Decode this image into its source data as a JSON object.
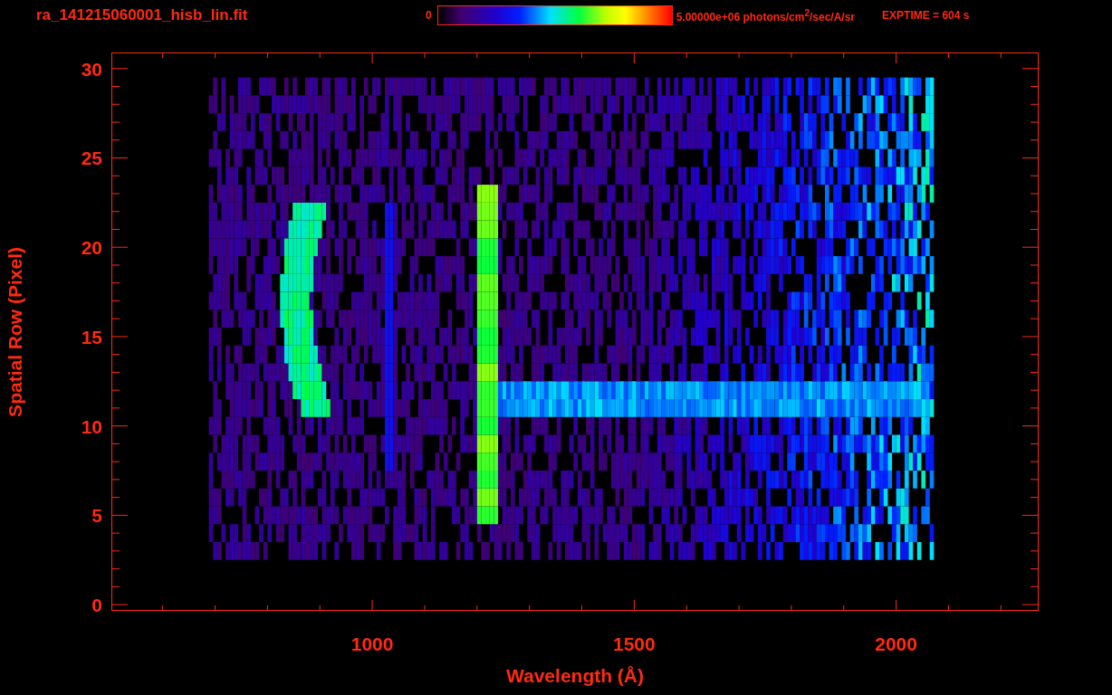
{
  "header": {
    "title": "ra_141215060001_hisb_lin.fit",
    "colorbar_min": "0",
    "colorbar_max": "5.00000e+06 photons/cm$^{2}$/sec/A/sr",
    "exposure": "EXPTIME = 604 s"
  },
  "plot": {
    "ylabel": "Spatial Row (Pixel)",
    "xlabel": "Wavelength (Å)",
    "xticks": [
      "1000",
      "1500",
      "2000"
    ],
    "yticks": [
      "30",
      "25",
      "20",
      "15",
      "10",
      "5",
      "0"
    ]
  }
}
